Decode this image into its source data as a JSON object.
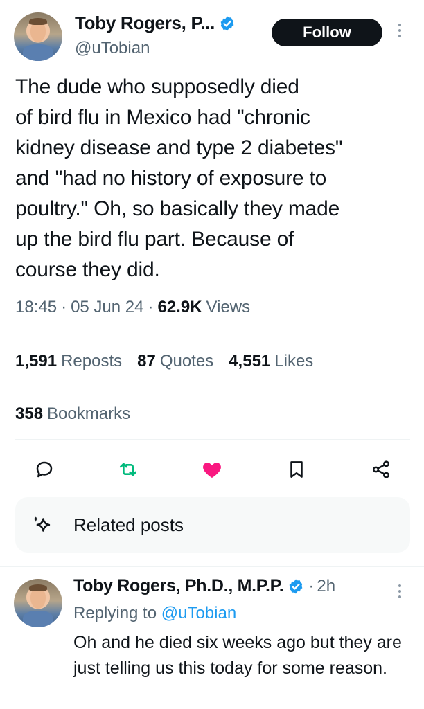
{
  "main_tweet": {
    "author_name": "Toby Rogers, P...",
    "handle": "@uTobian",
    "follow_label": "Follow",
    "text": "The dude who supposedly died\nof bird flu in Mexico had \"chronic\nkidney disease and type 2 diabetes\"\nand \"had no history of exposure to\npoultry.\" Oh, so basically they made\nup the bird flu part. Because of\ncourse they did.",
    "time": "18:45",
    "date": "05 Jun 24",
    "views_count": "62.9K",
    "views_label": "Views",
    "stats": {
      "reposts_count": "1,591",
      "reposts_label": "Reposts",
      "quotes_count": "87",
      "quotes_label": "Quotes",
      "likes_count": "4,551",
      "likes_label": "Likes"
    },
    "bookmarks_count": "358",
    "bookmarks_label": "Bookmarks",
    "actions": [
      "reply-icon",
      "repost-icon",
      "like-icon",
      "bookmark-icon",
      "share-icon"
    ],
    "related_label": "Related posts"
  },
  "reply": {
    "author_name": "Toby Rogers, Ph.D., M.P.P.",
    "time": "2h",
    "replying_prefix": "Replying to",
    "replying_handle": "@uTobian",
    "text": "Oh and he died six weeks ago but they are just telling us this today for some reason."
  },
  "colors": {
    "verified": "#1d9bf0",
    "repost_active": "#00ba7c",
    "like_active": "#f91880",
    "secondary_text": "#536471"
  }
}
